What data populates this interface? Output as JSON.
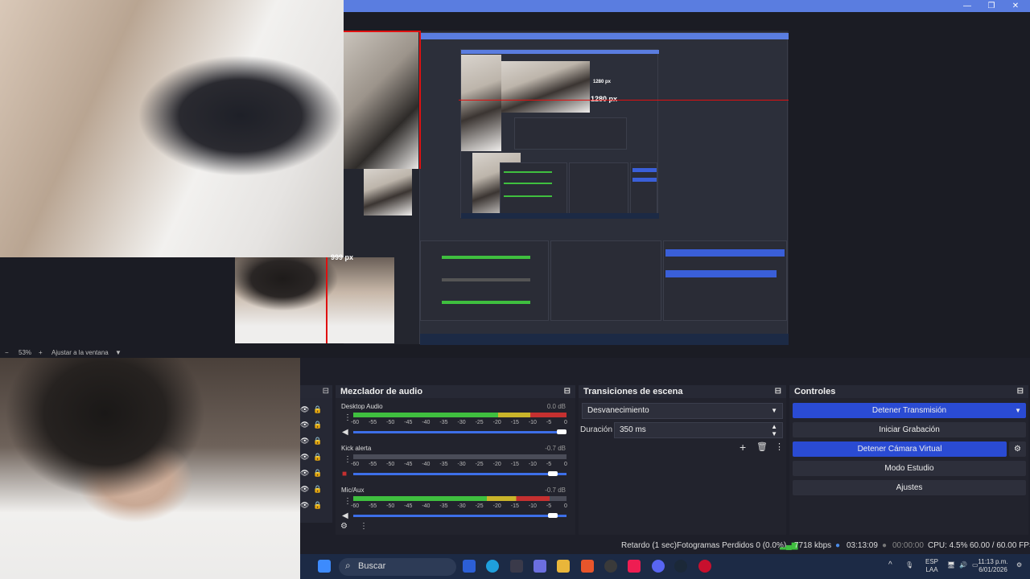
{
  "window": {
    "min_glyph": "—",
    "max_glyph": "❐",
    "close_glyph": "✕"
  },
  "preview": {
    "nested_label_1": "1280 px",
    "nested_label_2": "1280 px",
    "overlay_label": "999 px"
  },
  "zoom": {
    "minus": "−",
    "value": "53%",
    "plus": "+",
    "fit_label": "Ajustar a la ventana",
    "dropdown": "▼"
  },
  "mixer": {
    "title": "Mezclador de audio",
    "scale": [
      "-60",
      "-55",
      "-50",
      "-45",
      "-40",
      "-35",
      "-30",
      "-25",
      "-20",
      "-15",
      "-10",
      "-5",
      "0"
    ],
    "channels": [
      {
        "name": "Desktop Audio",
        "db": "0.0 dB",
        "level": 1.0,
        "volume": 1.0
      },
      {
        "name": "Kick alerta",
        "db": "-0.7 dB",
        "level": 0.0,
        "volume": 0.96
      },
      {
        "name": "Mic/Aux",
        "db": "-0.7 dB",
        "level": 0.92,
        "volume": 0.96
      }
    ]
  },
  "transitions": {
    "title": "Transiciones de escena",
    "selected": "Desvanecimiento",
    "duration_label": "Duración",
    "duration_value": "350 ms"
  },
  "controls": {
    "title": "Controles",
    "buttons": [
      {
        "label": "Detener Transmisión",
        "active": true
      },
      {
        "label": "Iniciar Grabación",
        "active": false
      },
      {
        "label": "Detener Cámara Virtual",
        "active": true
      },
      {
        "label": "Modo Estudio",
        "active": false
      },
      {
        "label": "Ajustes",
        "active": false
      }
    ]
  },
  "status": {
    "delay": "Retardo (1 sec)",
    "dropped": "Fotogramas Perdidos 0 (0.0%)",
    "bitrate": "7718 kbps",
    "stream_time": "03:13:09",
    "rec_time": "00:00:00",
    "cpu": "CPU: 4.5%",
    "fps": "60.00 / 60.00 FPS"
  },
  "taskbar": {
    "search_placeholder": "Buscar",
    "lang_line1": "ESP",
    "lang_line2": "LAA",
    "time": "11:13 p.m.",
    "date": "6/01/2026"
  },
  "colors": {
    "accent": "#2a4bd3",
    "titlebar": "#5a7de0",
    "meter_green": "#3fbf3f",
    "meter_yellow": "#c9b42a",
    "meter_red": "#c53030"
  }
}
